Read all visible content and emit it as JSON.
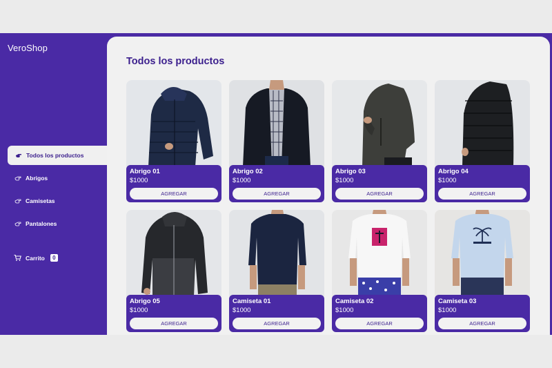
{
  "brand": "VeroShop",
  "nav": [
    {
      "label": "Todos los productos",
      "icon": "hand-pointer-icon"
    },
    {
      "label": "Abrigos",
      "icon": "hand-pointer-icon"
    },
    {
      "label": "Camisetas",
      "icon": "hand-pointer-icon"
    },
    {
      "label": "Pantalones",
      "icon": "hand-pointer-icon"
    }
  ],
  "cart": {
    "label": "Carrito",
    "count": "0",
    "icon": "cart-icon"
  },
  "main": {
    "title": "Todos los productos"
  },
  "products": [
    {
      "name": "Abrigo 01",
      "price": "$1000",
      "button": "AGREGAR"
    },
    {
      "name": "Abrigo 02",
      "price": "$1000",
      "button": "AGREGAR"
    },
    {
      "name": "Abrigo 03",
      "price": "$1000",
      "button": "AGREGAR"
    },
    {
      "name": "Abrigo 04",
      "price": "$1000",
      "button": "AGREGAR"
    },
    {
      "name": "Abrigo 05",
      "price": "$1000",
      "button": "AGREGAR"
    },
    {
      "name": "Camiseta 01",
      "price": "$1000",
      "button": "AGREGAR"
    },
    {
      "name": "Camiseta 02",
      "price": "$1000",
      "button": "AGREGAR"
    },
    {
      "name": "Camiseta 03",
      "price": "$1000",
      "button": "AGREGAR"
    }
  ],
  "colors": {
    "primary": "#4a2aa5",
    "title": "#3b1f8d",
    "background": "#f1f1f1"
  }
}
